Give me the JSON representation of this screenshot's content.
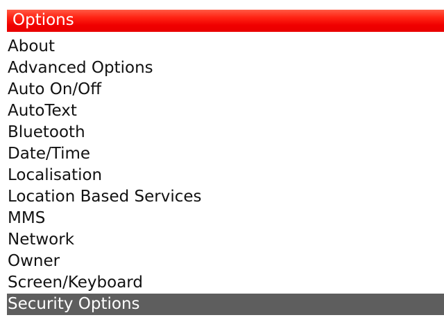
{
  "screen": {
    "title": "Options"
  },
  "menu": {
    "items": [
      {
        "label": "About"
      },
      {
        "label": "Advanced Options"
      },
      {
        "label": "Auto On/Off"
      },
      {
        "label": "AutoText"
      },
      {
        "label": "Bluetooth"
      },
      {
        "label": "Date/Time"
      },
      {
        "label": "Localisation"
      },
      {
        "label": "Location Based Services"
      },
      {
        "label": "MMS"
      },
      {
        "label": "Network"
      },
      {
        "label": "Owner"
      },
      {
        "label": "Screen/Keyboard"
      },
      {
        "label": "Security Options",
        "selected": true
      }
    ]
  },
  "colors": {
    "title_bar": "#f00000",
    "title_text": "#ffffff",
    "selection_highlight": "#5e5e5e",
    "list_text": "#111111",
    "background": "#ffffff"
  }
}
